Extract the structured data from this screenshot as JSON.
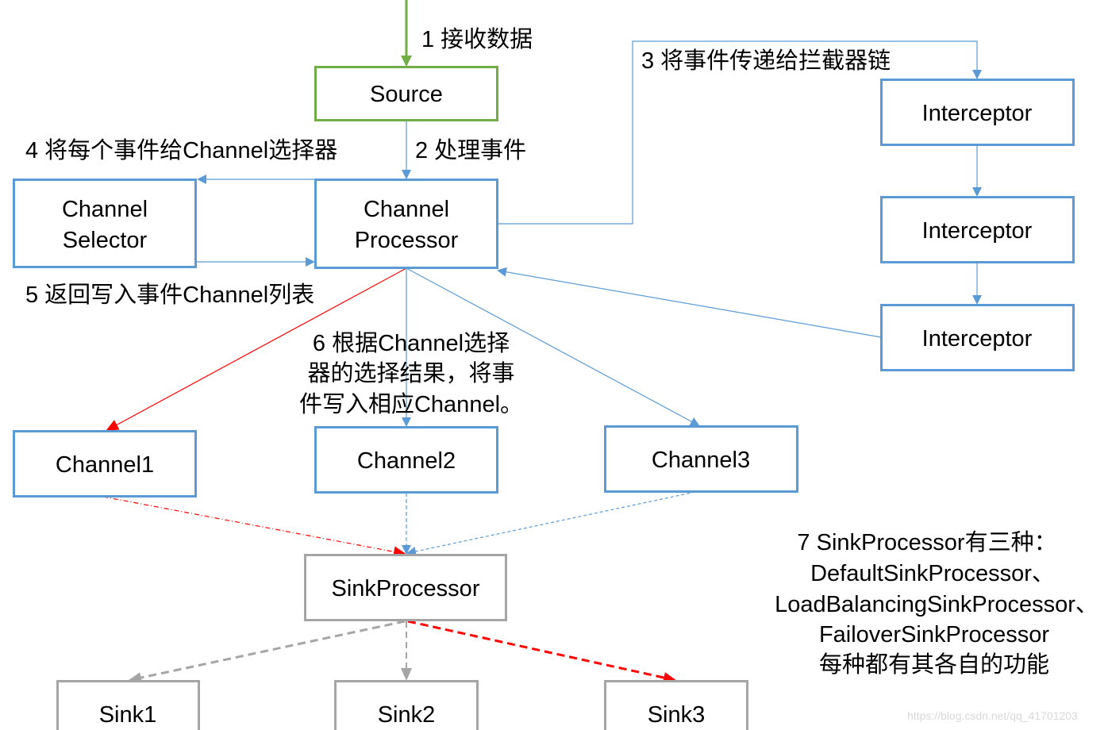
{
  "colors": {
    "blue": "#5B9BD5",
    "green": "#70AD47",
    "gray": "#A5A5A5",
    "red": "#FF0000"
  },
  "nodes": {
    "source": "Source",
    "channel_selector": [
      "Channel",
      "Selector"
    ],
    "channel_processor": [
      "Channel",
      "Processor"
    ],
    "interceptor1": "Interceptor",
    "interceptor2": "Interceptor",
    "interceptor3": "Interceptor",
    "channel1": "Channel1",
    "channel2": "Channel2",
    "channel3": "Channel3",
    "sink_processor": "SinkProcessor",
    "sink1": "Sink1",
    "sink2": "Sink2",
    "sink3": "Sink3"
  },
  "labels": {
    "step1": "1 接收数据",
    "step2": "2 处理事件",
    "step3": "3 将事件传递给拦截器链",
    "step4": "4 将每个事件给Channel选择器",
    "step5": "5 返回写入事件Channel列表",
    "step6": [
      "6 根据Channel选择",
      "器的选择结果，将事",
      "件写入相应Channel。"
    ],
    "step7": [
      "7 SinkProcessor有三种：",
      "DefaultSinkProcessor、",
      "LoadBalancingSinkProcessor、",
      "FailoverSinkProcessor",
      "每种都有其各自的功能"
    ]
  },
  "watermark": "https://blog.csdn.net/qq_41701203"
}
